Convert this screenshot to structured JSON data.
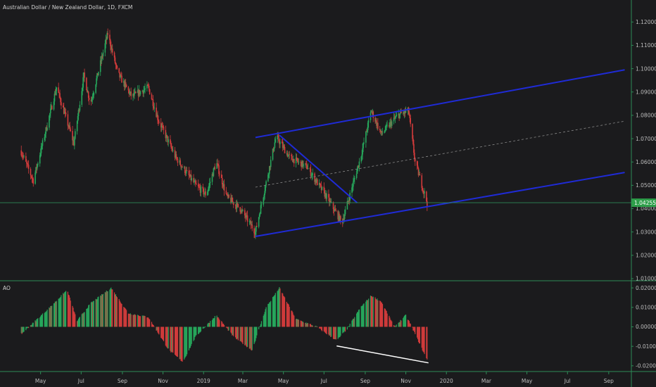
{
  "title": "Australian Dollar / New Zealand Dollar, 1D, FXCM",
  "indicator_label": "AO",
  "colors": {
    "background": "#1b1b1d",
    "axis_line": "#2e8b57",
    "bull": "#26a65b",
    "bear": "#d13b3b",
    "channel": "#1f2bd6",
    "midline": "#8a8a8a",
    "price_tag": "#2e9e4a",
    "divergence": "#ffffff"
  },
  "price_tag": "1.04255",
  "chart_data": [
    {
      "type": "candlestick",
      "title": "Australian Dollar / New Zealand Dollar, 1D, FXCM",
      "y_ticks": [
        "1.12000",
        "1.11000",
        "1.10000",
        "1.09000",
        "1.08000",
        "1.07000",
        "1.06000",
        "1.05000",
        "1.04000",
        "1.03000",
        "1.02000",
        "1.01000"
      ],
      "ylim": [
        1.01,
        1.124
      ],
      "x_ticks": [
        "May",
        "Jul",
        "Sep",
        "Nov",
        "2019",
        "Mar",
        "May",
        "Jul",
        "Sep",
        "Nov",
        "2020",
        "Mar",
        "May",
        "Jul",
        "Sep"
      ],
      "current_price": 1.04255,
      "key_points": [
        {
          "date": "2018-04-01",
          "price": 1.065
        },
        {
          "date": "2018-04-20",
          "price": 1.052
        },
        {
          "date": "2018-05-25",
          "price": 1.092
        },
        {
          "date": "2018-06-20",
          "price": 1.068
        },
        {
          "date": "2018-07-05",
          "price": 1.097
        },
        {
          "date": "2018-07-15",
          "price": 1.085
        },
        {
          "date": "2018-08-10",
          "price": 1.115
        },
        {
          "date": "2018-08-25",
          "price": 1.098
        },
        {
          "date": "2018-09-15",
          "price": 1.088
        },
        {
          "date": "2018-10-10",
          "price": 1.092
        },
        {
          "date": "2018-10-25",
          "price": 1.078
        },
        {
          "date": "2018-11-20",
          "price": 1.062
        },
        {
          "date": "2018-12-20",
          "price": 1.05
        },
        {
          "date": "2019-01-05",
          "price": 1.046
        },
        {
          "date": "2019-01-20",
          "price": 1.06
        },
        {
          "date": "2019-02-05",
          "price": 1.045
        },
        {
          "date": "2019-02-25",
          "price": 1.04
        },
        {
          "date": "2019-03-20",
          "price": 1.03
        },
        {
          "date": "2019-04-20",
          "price": 1.071
        },
        {
          "date": "2019-05-10",
          "price": 1.062
        },
        {
          "date": "2019-06-05",
          "price": 1.058
        },
        {
          "date": "2019-07-05",
          "price": 1.045
        },
        {
          "date": "2019-07-28",
          "price": 1.034
        },
        {
          "date": "2019-08-25",
          "price": 1.062
        },
        {
          "date": "2019-09-10",
          "price": 1.082
        },
        {
          "date": "2019-09-25",
          "price": 1.072
        },
        {
          "date": "2019-10-20",
          "price": 1.08
        },
        {
          "date": "2019-11-05",
          "price": 1.082
        },
        {
          "date": "2019-11-15",
          "price": 1.06
        },
        {
          "date": "2019-12-03",
          "price": 1.0425
        }
      ],
      "annotations": [
        {
          "type": "channel_upper",
          "from": {
            "date": "2019-03-20",
            "price": 1.0705
          },
          "to": {
            "date": "2020-09-25",
            "price": 1.0995
          }
        },
        {
          "type": "channel_midline",
          "from": {
            "date": "2019-03-20",
            "price": 1.0492
          },
          "to": {
            "date": "2020-09-25",
            "price": 1.0775
          }
        },
        {
          "type": "channel_lower",
          "from": {
            "date": "2019-03-20",
            "price": 1.0281
          },
          "to": {
            "date": "2020-09-25",
            "price": 1.0555
          }
        },
        {
          "type": "trendline",
          "from": {
            "date": "2019-04-25",
            "price": 1.0715
          },
          "to": {
            "date": "2019-08-20",
            "price": 1.0425
          }
        },
        {
          "type": "horizontal_line",
          "price": 1.04255
        }
      ]
    },
    {
      "type": "histogram",
      "title": "AO",
      "y_ticks": [
        "0.02000",
        "0.01000",
        "0.00000",
        "-0.01000",
        "-0.02000"
      ],
      "ylim": [
        -0.0215,
        0.0215
      ],
      "key_points": [
        {
          "date": "2018-04-01",
          "value": -0.004
        },
        {
          "date": "2018-05-15",
          "value": 0.01
        },
        {
          "date": "2018-06-10",
          "value": 0.019
        },
        {
          "date": "2018-06-25",
          "value": 0.003
        },
        {
          "date": "2018-07-15",
          "value": 0.012
        },
        {
          "date": "2018-08-15",
          "value": 0.02
        },
        {
          "date": "2018-09-10",
          "value": 0.007
        },
        {
          "date": "2018-10-10",
          "value": 0.005
        },
        {
          "date": "2018-11-10",
          "value": -0.012
        },
        {
          "date": "2018-12-01",
          "value": -0.018
        },
        {
          "date": "2018-12-20",
          "value": -0.005
        },
        {
          "date": "2019-01-20",
          "value": 0.006
        },
        {
          "date": "2019-02-15",
          "value": -0.005
        },
        {
          "date": "2019-03-15",
          "value": -0.012
        },
        {
          "date": "2019-04-05",
          "value": 0.01
        },
        {
          "date": "2019-04-25",
          "value": 0.02
        },
        {
          "date": "2019-05-20",
          "value": 0.004
        },
        {
          "date": "2019-06-20",
          "value": 0.0
        },
        {
          "date": "2019-07-20",
          "value": -0.007
        },
        {
          "date": "2019-08-05",
          "value": -0.001
        },
        {
          "date": "2019-08-25",
          "value": 0.01
        },
        {
          "date": "2019-09-10",
          "value": 0.016
        },
        {
          "date": "2019-09-25",
          "value": 0.013
        },
        {
          "date": "2019-10-15",
          "value": 0.0
        },
        {
          "date": "2019-11-01",
          "value": 0.006
        },
        {
          "date": "2019-11-10",
          "value": 0.0
        },
        {
          "date": "2019-12-03",
          "value": -0.017
        }
      ],
      "annotations": [
        {
          "type": "divergence_line",
          "from": {
            "date": "2019-07-20",
            "value": -0.0098
          },
          "to": {
            "date": "2019-12-05",
            "value": -0.0185
          }
        }
      ]
    }
  ]
}
